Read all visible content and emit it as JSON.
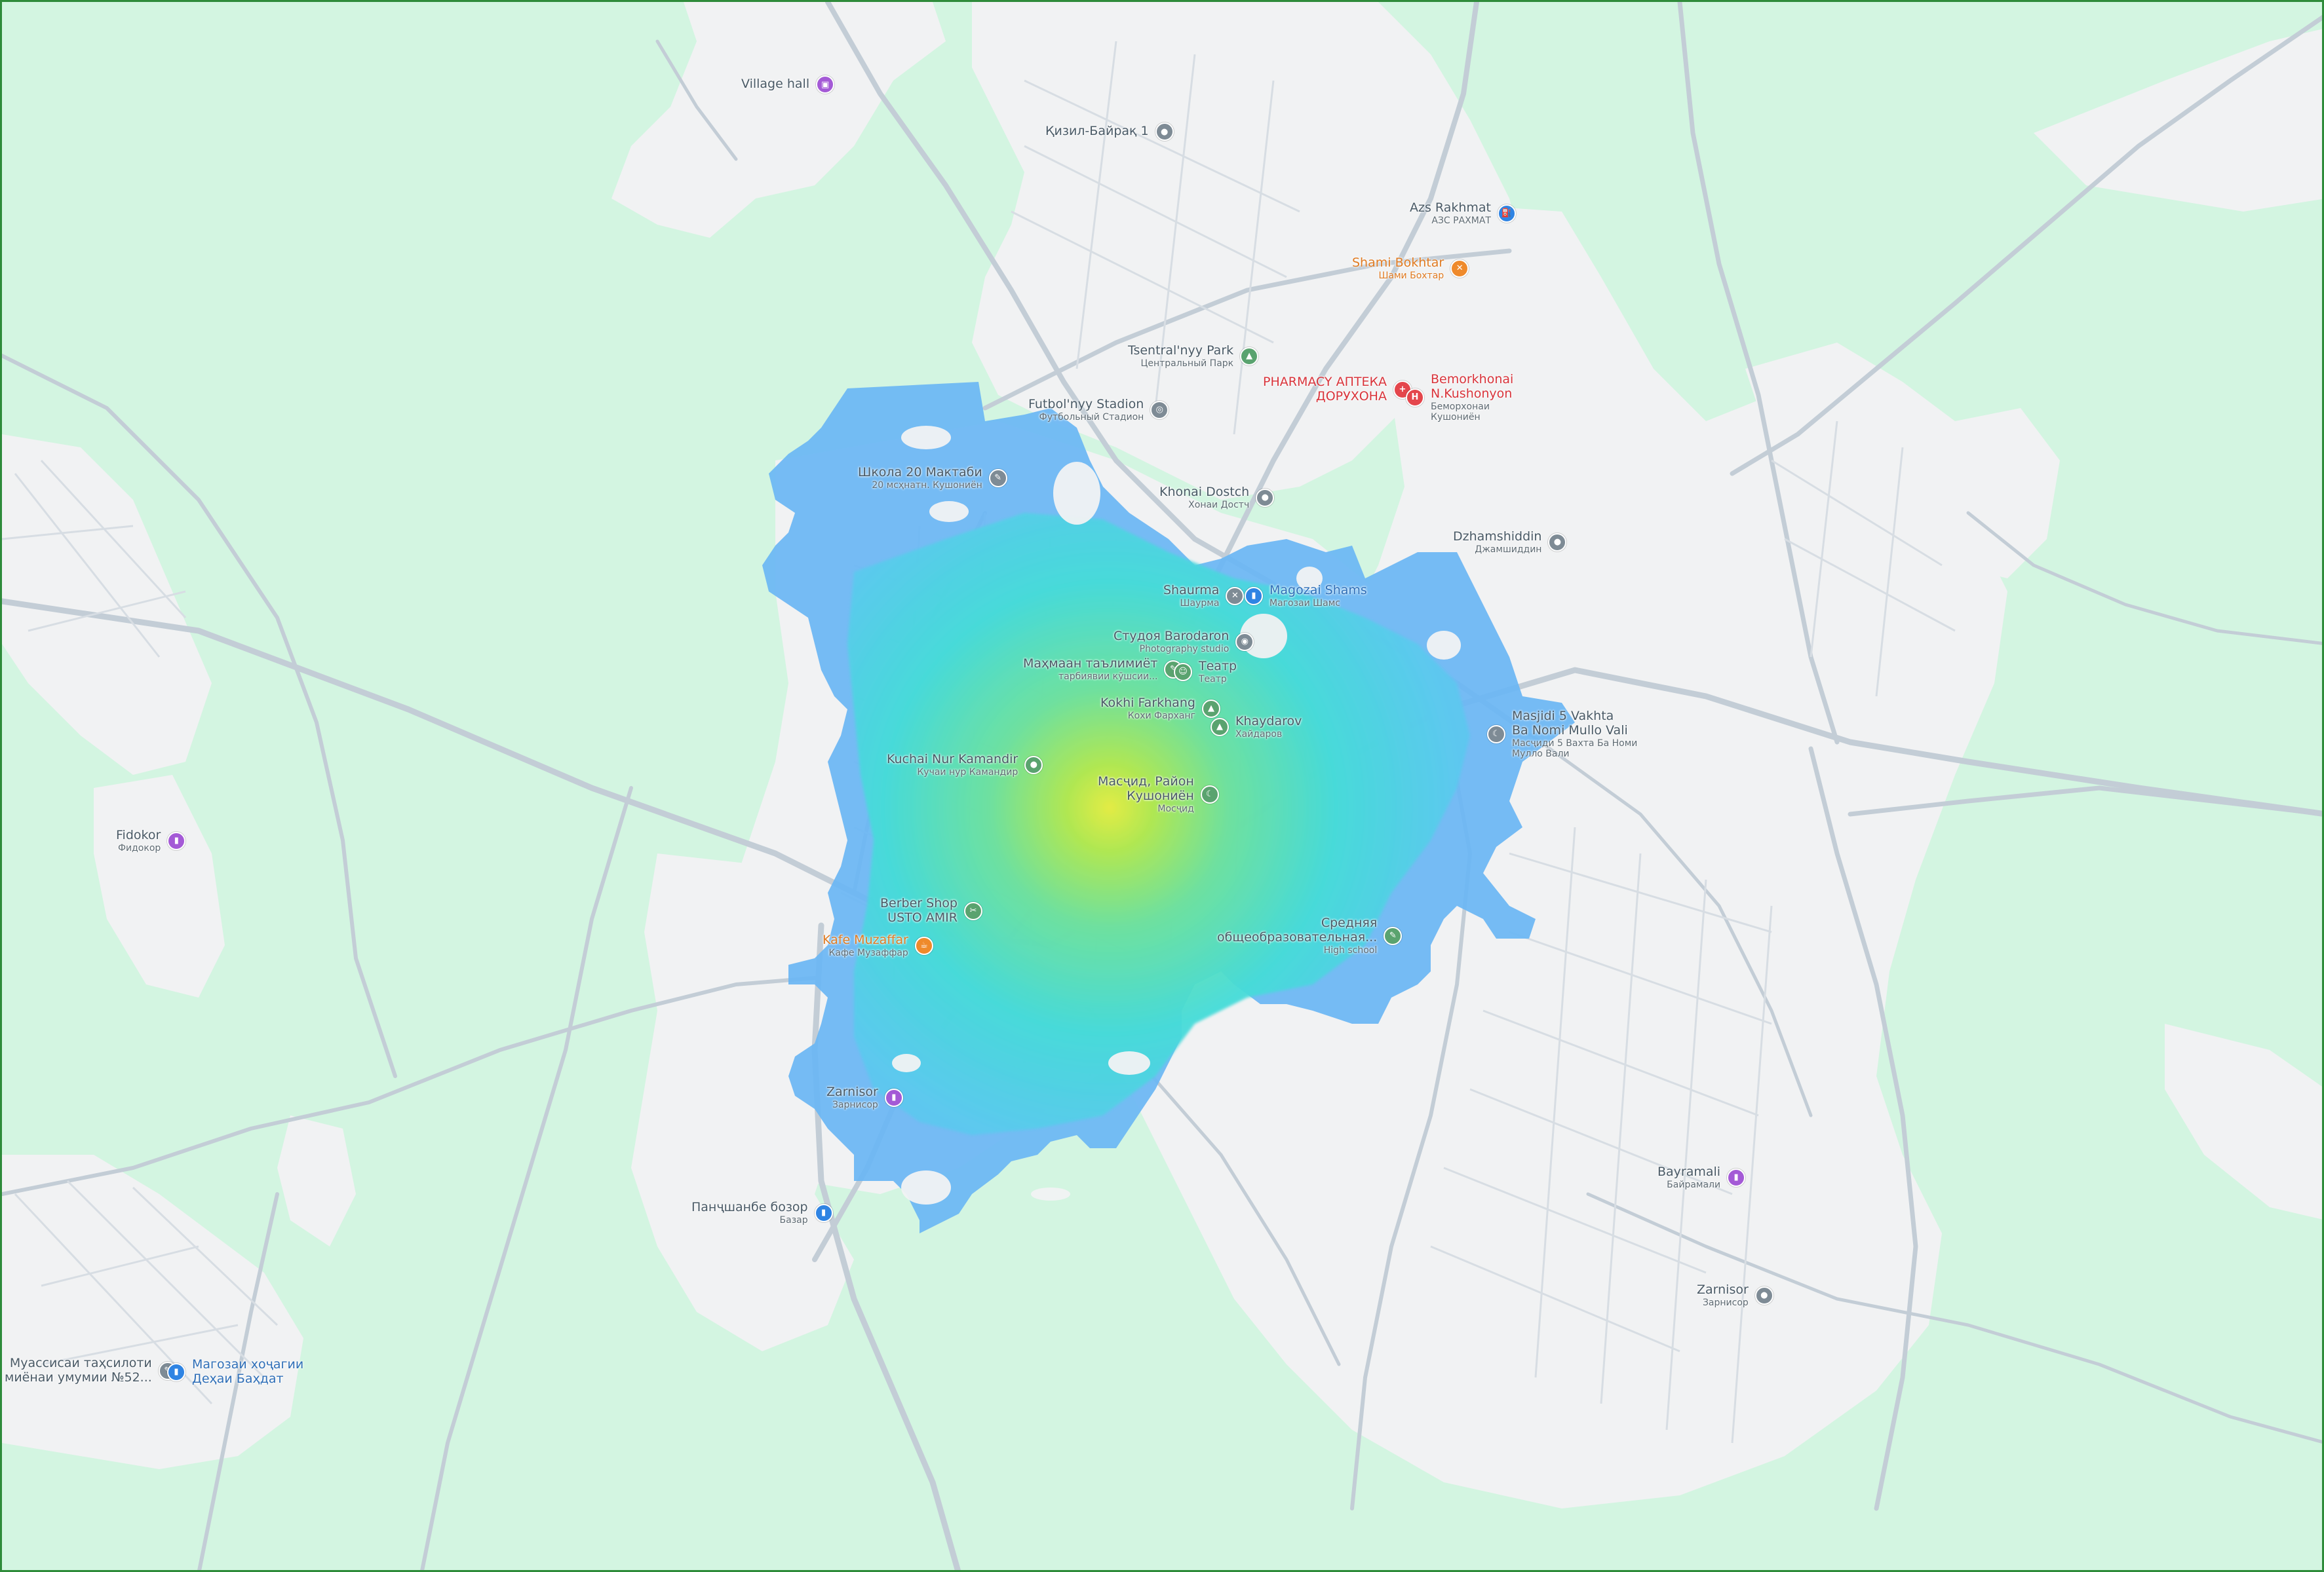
{
  "map": {
    "colors": {
      "land": "#d3f5e1",
      "urban": "#f1f2f3",
      "road": "#c3cdd6",
      "border": "#2e8b3a",
      "pin_gray": "#7e8b95",
      "pin_green": "#5aa36f",
      "pin_blue": "#2f84e3",
      "pin_purple": "#a45ad6",
      "pin_orange": "#ef8a2b",
      "pin_red": "#e4464c",
      "heat_low": "#6fbcf5",
      "heat_mid": "#44e4d6",
      "heat_high": "#c8ea3a"
    },
    "pois": [
      {
        "id": "village-hall",
        "name": "Village hall",
        "sub": "",
        "icon": "village-hall-icon",
        "color": "pin_purple"
      },
      {
        "id": "qizil-bayraq",
        "name": "Қизил-Байрақ 1",
        "sub": "",
        "icon": "location-pin-icon",
        "color": "pin_gray"
      },
      {
        "id": "azs-rakhmat",
        "name": "Azs Rakhmat",
        "sub": "АЗС РАХМАТ",
        "icon": "gas-station-icon",
        "color": "pin_blue"
      },
      {
        "id": "shami-bokhtar",
        "name": "Shami Bokhtar",
        "sub": "Шами Бохтар",
        "icon": "restaurant-icon",
        "color": "pin_orange"
      },
      {
        "id": "tsentralnyy-park",
        "name": "Tsentral'nyy Park",
        "sub": "Центральный Парк",
        "icon": "park-icon",
        "color": "pin_green"
      },
      {
        "id": "pharmacy",
        "name": "PHARMACY АПТЕКА",
        "sub": "ДОРУХОНА",
        "icon": "pharmacy-icon",
        "color": "pin_red"
      },
      {
        "id": "bemorkhonai",
        "name": "Bemorkhonai N.Kushonyon",
        "sub": "Беморхонаи Кушониён",
        "icon": "hospital-icon",
        "color": "pin_red"
      },
      {
        "id": "futbolnyy-stadion",
        "name": "Futbol'nyy Stadion",
        "sub": "Футбольный Стадион",
        "icon": "stadium-icon",
        "color": "pin_gray"
      },
      {
        "id": "shkola-20",
        "name": "Школа 20 Мактаби",
        "sub": "20 мсҳнатн. Кушониён",
        "icon": "school-icon",
        "color": "pin_gray"
      },
      {
        "id": "khonai-dostch",
        "name": "Khonai Dostch",
        "sub": "Хонаи Достч",
        "icon": "location-pin-icon",
        "color": "pin_gray"
      },
      {
        "id": "dzhamshiddin",
        "name": "Dzhamshiddin",
        "sub": "Джамшиддин",
        "icon": "location-pin-icon",
        "color": "pin_gray"
      },
      {
        "id": "shaurma",
        "name": "Shaurma",
        "sub": "Шаурма",
        "icon": "restaurant-icon",
        "color": "pin_gray"
      },
      {
        "id": "magozai-shams",
        "name": "Magozai Shams",
        "sub": "Магозаи Шамс",
        "icon": "shopping-bag-icon",
        "color": "pin_blue"
      },
      {
        "id": "studoi-barodaron",
        "name": "Студоя Barodaron",
        "sub": "Photography studio",
        "icon": "camera-icon",
        "color": "pin_gray"
      },
      {
        "id": "mahmaan",
        "name": "Маҳмаан таълимиёт",
        "sub": "тарбиявии кӯшсии...",
        "icon": "school-icon",
        "color": "pin_green"
      },
      {
        "id": "teatr",
        "name": "Театр",
        "sub": "Театр",
        "icon": "theater-icon",
        "color": "pin_green"
      },
      {
        "id": "kokhi-farkhang",
        "name": "Kokhi Farkhang",
        "sub": "Кохи Фарханг",
        "icon": "landmark-icon",
        "color": "pin_green"
      },
      {
        "id": "khaydarov",
        "name": "Khaydarov",
        "sub": "Хайдаров",
        "icon": "landmark-icon",
        "color": "pin_green"
      },
      {
        "id": "masjidi-5-vakhta",
        "name": "Masjidi 5 Vakhta",
        "sub": "Ba Nomi Mullo Vali",
        "sub2": "Масҷиди 5 Вахта Ба Номи Мулло Вали",
        "icon": "mosque-icon",
        "color": "pin_gray"
      },
      {
        "id": "kuchai-nur-kamandir",
        "name": "Kuchai Nur Kamandir",
        "sub": "Кучаи нур Камандир",
        "icon": "location-pin-icon",
        "color": "pin_green"
      },
      {
        "id": "masjid-rayon",
        "name": "Масҷид, Район",
        "sub": "Кушониён",
        "sub2": "Мосҷид",
        "icon": "mosque-icon",
        "color": "pin_green"
      },
      {
        "id": "fidokor",
        "name": "Fidokor",
        "sub": "Фидокор",
        "icon": "shopping-bag-icon",
        "color": "pin_purple"
      },
      {
        "id": "berber-shop",
        "name": "Berber Shop",
        "sub": "USTO AMIR",
        "icon": "barber-icon",
        "color": "pin_green"
      },
      {
        "id": "kafe-muzaffar",
        "name": "Kafe Muzaffar",
        "sub": "Кафе Музаффар",
        "icon": "cafe-icon",
        "color": "pin_orange"
      },
      {
        "id": "srednyaya-shkola",
        "name": "Средняя",
        "sub": "общеобразовательная...",
        "sub2": "High school",
        "icon": "school-icon",
        "color": "pin_green"
      },
      {
        "id": "zarnisor-west",
        "name": "Zarnisor",
        "sub": "Зарнисор",
        "icon": "shopping-bag-icon",
        "color": "pin_purple"
      },
      {
        "id": "panjshanbe-bozor",
        "name": "Панҷшанбе бозор",
        "sub": "Базар",
        "icon": "market-icon",
        "color": "pin_blue"
      },
      {
        "id": "bayramali",
        "name": "Bayramali",
        "sub": "Байрамали",
        "icon": "shopping-bag-icon",
        "color": "pin_purple"
      },
      {
        "id": "zarnisor-east",
        "name": "Zarnisor",
        "sub": "Зарнисор",
        "icon": "location-pin-icon",
        "color": "pin_gray"
      },
      {
        "id": "muassisai",
        "name": "Муассисаи таҳсилоти",
        "sub": "миёнаи умумии №52...",
        "icon": "school-icon",
        "color": "pin_gray"
      },
      {
        "id": "magozai-khojagii",
        "name": "Магозаи хоҷагии",
        "sub": "Деҳаи Баҳдат",
        "icon": "shopping-bag-icon",
        "color": "pin_blue"
      }
    ]
  }
}
